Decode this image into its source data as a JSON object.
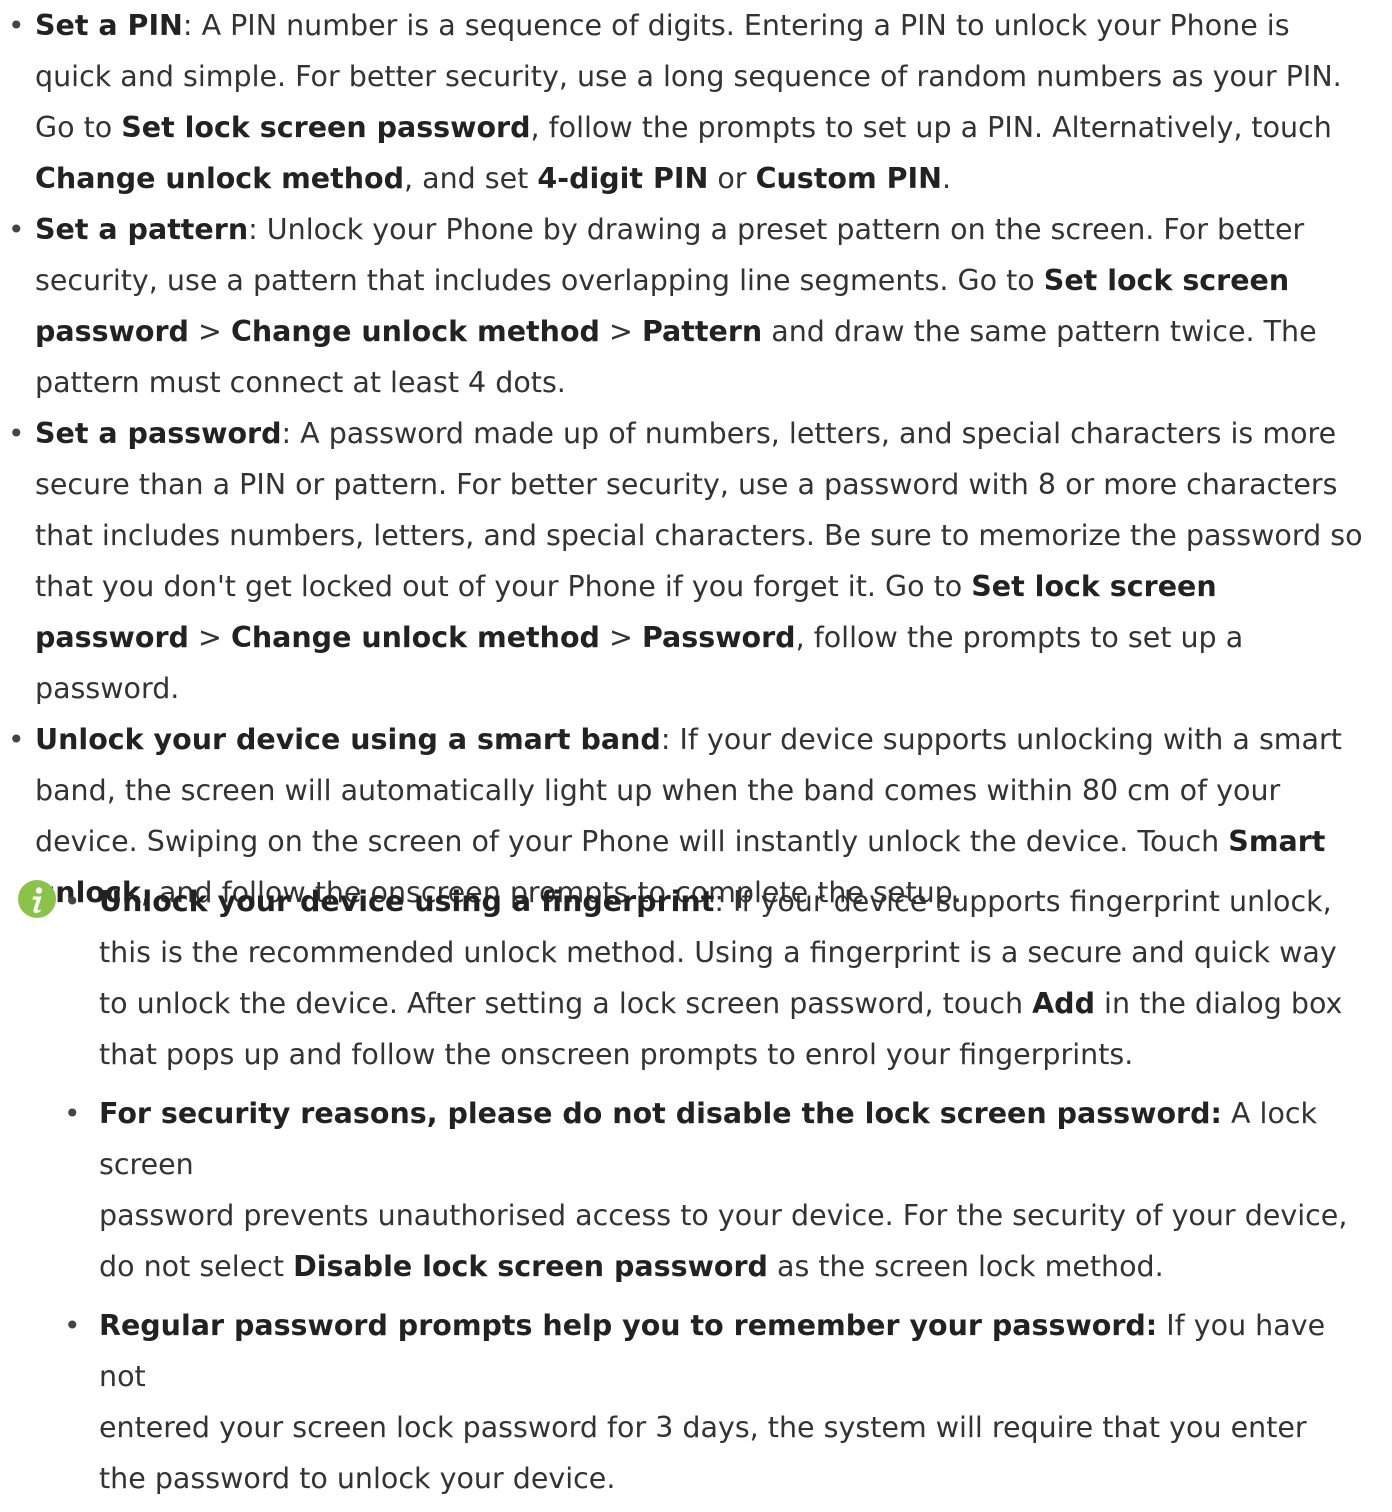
{
  "items": [
    {
      "lines": [
        [
          "Set a PIN",
          ": A PIN number is a sequence of digits. Entering a PIN to unlock your Phone is"
        ],
        [
          "",
          "quick and simple. For better security, use a long sequence of random numbers as your PIN."
        ],
        [
          "",
          "Go to ",
          "Set lock screen password",
          ", follow the prompts to set up a PIN. Alternatively, touch"
        ],
        [
          "",
          "",
          "Change unlock method",
          ", and set ",
          "4-digit PIN",
          " or ",
          "Custom PIN",
          "."
        ]
      ]
    }
  ],
  "main": {
    "pin": {
      "title": "Set a PIN",
      "l1": ": A PIN number is a sequence of digits. Entering a PIN to unlock your Phone is",
      "l2": "quick and simple. For better security, use a long sequence of random numbers as your PIN.",
      "l3a": "Go to ",
      "l3b": "Set lock screen password",
      "l3c": ", follow the prompts to set up a PIN. Alternatively, touch",
      "l4a": "Change unlock method",
      "l4b": ", and set ",
      "l4c": "4-digit PIN",
      "l4d": " or ",
      "l4e": "Custom PIN",
      "l4f": "."
    },
    "pattern": {
      "title": "Set a pattern",
      "l1": ": Unlock your Phone by drawing a preset pattern on the screen. For better",
      "l2a": "security, use a pattern that includes overlapping line segments. Go to ",
      "l2b": "Set lock screen",
      "l3a": "password",
      "l3b": " > ",
      "l3c": "Change unlock method",
      "l3d": " > ",
      "l3e": "Pattern",
      "l3f": " and draw the same pattern twice. The",
      "l4": "pattern must connect at least 4 dots."
    },
    "password": {
      "title": "Set a password",
      "l1": ": A password made up of numbers, letters, and special characters is more",
      "l2": "secure than a PIN or pattern. For better security, use a password with 8 or more characters",
      "l3": "that includes numbers, letters, and special characters. Be sure to memorize the password so",
      "l4a": "that you don't get locked out of your Phone if you forget it. Go to ",
      "l4b": "Set lock screen",
      "l5a": "password",
      "l5b": " > ",
      "l5c": "Change unlock method",
      "l5d": " > ",
      "l5e": "Password",
      "l5f": ", follow the prompts to set up a password."
    },
    "band": {
      "title": "Unlock your device using a smart band",
      "l1": ": If your device supports unlocking with a smart",
      "l2": "band, the screen will automatically light up when the band comes within 80 cm of your",
      "l3a": "device. Swiping on the screen of your Phone will instantly unlock the device. Touch ",
      "l3b": "Smart",
      "l4a": "unlock",
      "l4b": ", and follow the onscreen prompts to complete the setup."
    }
  },
  "note": {
    "icon": "info-icon",
    "icon_color": "#8bc34a",
    "fingerprint": {
      "title": "Unlock your device using a fingerprint",
      "l1": ": If your device supports fingerprint unlock,",
      "l2": "this is the recommended unlock method. Using a fingerprint is a secure and quick way",
      "l3a": "to unlock the device. After setting a lock screen password, touch ",
      "l3b": "Add",
      "l3c": " in the dialog box",
      "l4": "that pops up and follow the onscreen prompts to enrol your fingerprints."
    },
    "security": {
      "title": "For security reasons, please do not disable the lock screen password:",
      "l1": " A lock screen",
      "l2": "password prevents unauthorised access to your device. For the security of your device,",
      "l3a": "do not select ",
      "l3b": "Disable lock screen password",
      "l3c": " as the screen lock method."
    },
    "regular": {
      "title": "Regular password prompts help you to remember your password:",
      "l1": " If you have not",
      "l2": "entered your screen lock password for 3 days, the system will require that you enter",
      "l3": "the password to unlock your device."
    }
  },
  "bullet_char": "•"
}
